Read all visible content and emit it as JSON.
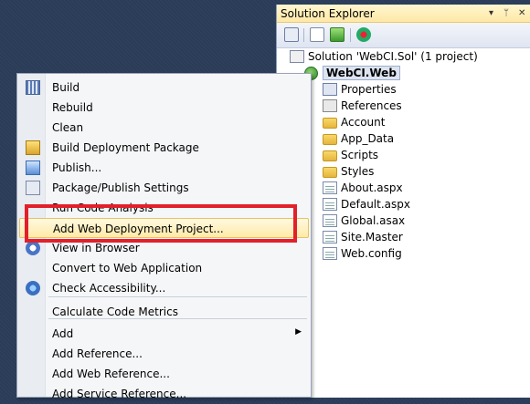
{
  "solution_explorer": {
    "title": "Solution Explorer",
    "pin_glyph": "▾",
    "pin2_glyph": "ᛘ",
    "close_glyph": "✕",
    "solution_label": "Solution 'WebCI.Sol' (1 project)",
    "project_label": "WebCI.Web",
    "items": [
      {
        "label": "Properties",
        "icon": "properties-icon"
      },
      {
        "label": "References",
        "icon": "references-icon"
      },
      {
        "label": "Account",
        "icon": "folder-icon"
      },
      {
        "label": "App_Data",
        "icon": "folder-icon"
      },
      {
        "label": "Scripts",
        "icon": "folder-icon"
      },
      {
        "label": "Styles",
        "icon": "folder-icon"
      },
      {
        "label": "About.aspx",
        "icon": "file-icon"
      },
      {
        "label": "Default.aspx",
        "icon": "file-icon"
      },
      {
        "label": "Global.asax",
        "icon": "file-icon"
      },
      {
        "label": "Site.Master",
        "icon": "file-icon"
      },
      {
        "label": "Web.config",
        "icon": "file-icon"
      }
    ]
  },
  "context_menu": {
    "items": [
      {
        "label": "Build"
      },
      {
        "label": "Rebuild"
      },
      {
        "label": "Clean"
      },
      {
        "label": "Build Deployment Package"
      },
      {
        "label": "Publish..."
      },
      {
        "label": "Package/Publish Settings"
      },
      {
        "label": "Run Code Analysis"
      },
      {
        "label": "Add Web Deployment Project..."
      },
      {
        "label": "View in Browser"
      },
      {
        "label": "Convert to Web Application"
      },
      {
        "label": "Check Accessibility..."
      },
      {
        "label": "Calculate Code Metrics"
      },
      {
        "label": "Add"
      },
      {
        "label": "Add Reference..."
      },
      {
        "label": "Add Web Reference..."
      },
      {
        "label": "Add Service Reference..."
      }
    ],
    "submenu_arrow": "▶"
  },
  "colors": {
    "highlight_box": "#e2202a",
    "menu_highlight": "#ffeaa8"
  }
}
